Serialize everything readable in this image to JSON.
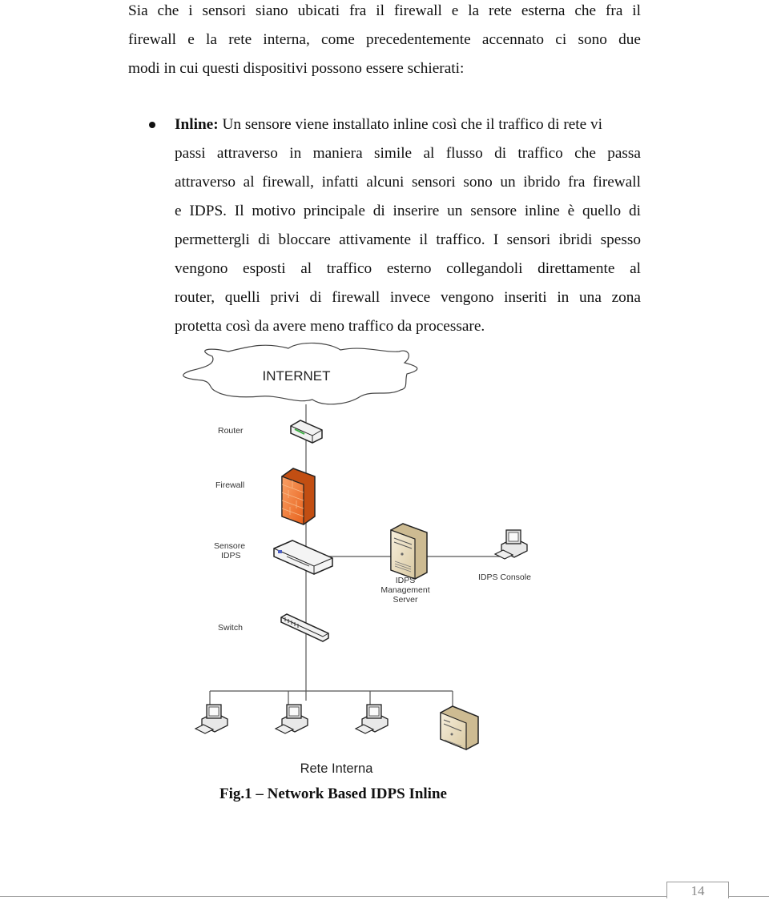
{
  "intro": {
    "lines": [
      "Sia che i sensori siano ubicati fra il firewall e la rete esterna che fra il",
      "firewall e la rete interna, come precedentemente accennato ci sono due",
      "modi in cui questi dispositivi possono essere schierati:"
    ]
  },
  "bullet": {
    "term": "Inline:",
    "first_line_rest": " Un sensore viene installato inline così che il traffico di rete vi",
    "lines": [
      "passi attraverso in maniera simile al flusso di traffico che passa",
      "attraverso al firewall, infatti alcuni sensori sono un ibrido fra firewall",
      "e IDPS.  Il motivo principale di inserire un sensore inline è quello di",
      "permettergli di bloccare attivamente il traffico. I sensori ibridi spesso",
      "vengono esposti al traffico esterno collegandoli direttamente al",
      "router, quelli privi di firewall invece vengono inseriti in una zona",
      "protetta così da avere meno traffico da processare."
    ]
  },
  "diagram": {
    "cloud_label": "INTERNET",
    "router_label": "Router",
    "firewall_label": "Firewall",
    "sensor_label_1": "Sensore",
    "sensor_label_2": "IDPS",
    "mgmt_label_1": "IDPS",
    "mgmt_label_2": "Management",
    "mgmt_label_3": "Server",
    "console_label": "IDPS Console",
    "switch_label": "Switch",
    "internal_label": "Rete Interna",
    "colors": {
      "firewall": "#f07a30",
      "server": "#e9dcc0",
      "device": "#f2f2f2",
      "line": "#555555"
    }
  },
  "caption": "Fig.1 – Network Based IDPS Inline",
  "page_number": "14"
}
